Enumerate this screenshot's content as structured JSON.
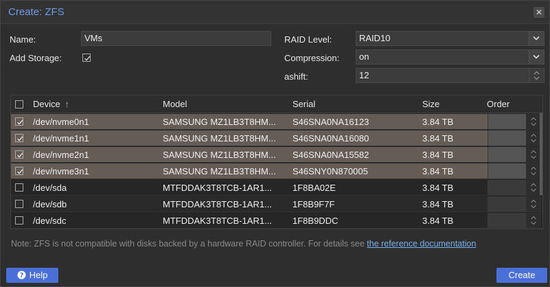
{
  "window": {
    "title": "Create: ZFS",
    "close_glyph": "✕"
  },
  "form": {
    "name_label": "Name:",
    "name_value": "VMs",
    "add_storage_label": "Add Storage:",
    "add_storage_checked": true,
    "raid_label": "RAID Level:",
    "raid_value": "RAID10",
    "compression_label": "Compression:",
    "compression_value": "on",
    "ashift_label": "ashift:",
    "ashift_value": "12"
  },
  "grid": {
    "columns": {
      "device": "Device",
      "sort_glyph": "↑",
      "model": "Model",
      "serial": "Serial",
      "size": "Size",
      "order": "Order"
    },
    "rows": [
      {
        "device": "/dev/nvme0n1",
        "model": "SAMSUNG MZ1LB3T8HM...",
        "serial": "S46SNA0NA16123",
        "size": "3.84 TB",
        "checked": true
      },
      {
        "device": "/dev/nvme1n1",
        "model": "SAMSUNG MZ1LB3T8HM...",
        "serial": "S46SNA0NA16080",
        "size": "3.84 TB",
        "checked": true
      },
      {
        "device": "/dev/nvme2n1",
        "model": "SAMSUNG MZ1LB3T8HM...",
        "serial": "S46SNA0NA15582",
        "size": "3.84 TB",
        "checked": true
      },
      {
        "device": "/dev/nvme3n1",
        "model": "SAMSUNG MZ1LB3T8HM...",
        "serial": "S46SNY0N870005",
        "size": "3.84 TB",
        "checked": true
      },
      {
        "device": "/dev/sda",
        "model": "MTFDDAK3T8TCB-1AR1...",
        "serial": "1F8BA02E",
        "size": "3.84 TB",
        "checked": false
      },
      {
        "device": "/dev/sdb",
        "model": "MTFDDAK3T8TCB-1AR1...",
        "serial": "1F8B9F7F",
        "size": "3.84 TB",
        "checked": false
      },
      {
        "device": "/dev/sdc",
        "model": "MTFDDAK3T8TCB-1AR1...",
        "serial": "1F8B9DDC",
        "size": "3.84 TB",
        "checked": false
      }
    ]
  },
  "note": {
    "text": "Note: ZFS is not compatible with disks backed by a hardware RAID controller. For details see ",
    "link": "the reference documentation"
  },
  "buttons": {
    "help": "Help",
    "create": "Create"
  },
  "colors": {
    "accent": "#4a6fd6",
    "title": "#6f9ce8",
    "selected_row": "#645c55",
    "link": "#7ab0ef"
  },
  "icons": {
    "help": "question-circle-icon",
    "close": "close-icon",
    "check": "check-icon",
    "combo": "chevron-down-icon",
    "spinner": "spinner-arrows-icon"
  }
}
